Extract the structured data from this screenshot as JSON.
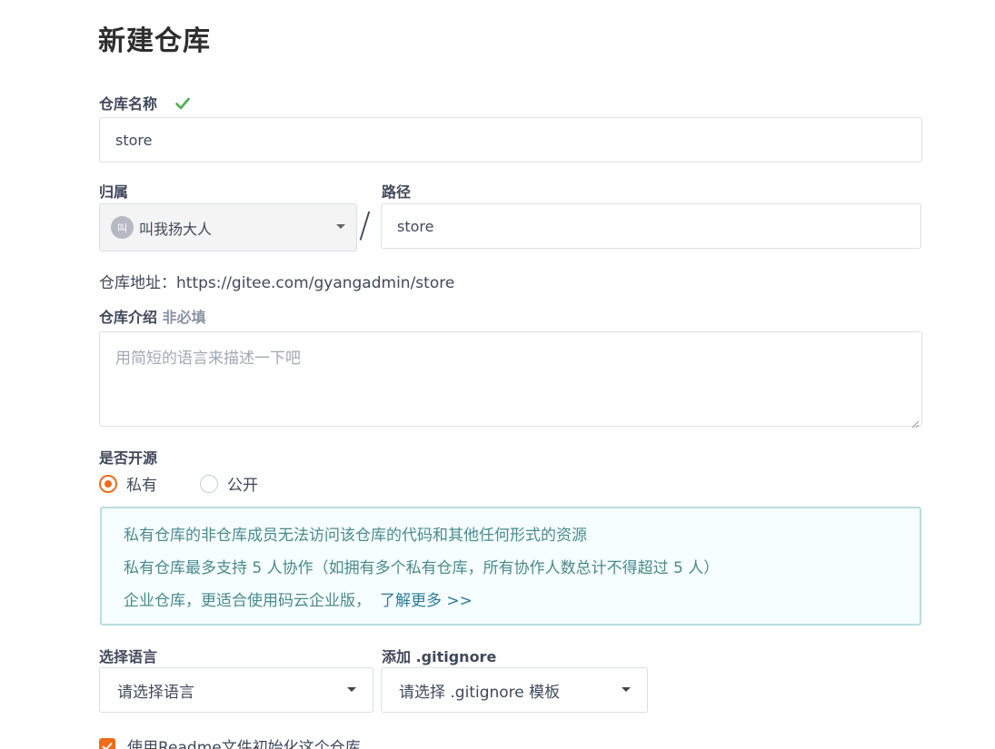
{
  "page": {
    "title": "新建仓库"
  },
  "repo_name": {
    "label": "仓库名称",
    "value": "store",
    "valid_icon": "check-icon"
  },
  "owner": {
    "label": "归属",
    "avatar_text": "叫",
    "value": "叫我扬大人"
  },
  "path": {
    "label": "路径",
    "separator": "/",
    "value": "store"
  },
  "address": {
    "text": "仓库地址：https://gitee.com/gyangadmin/store"
  },
  "description": {
    "label": "仓库介绍",
    "optional": "非必填",
    "placeholder": "用简短的语言来描述一下吧",
    "value": ""
  },
  "visibility": {
    "label": "是否开源",
    "options": [
      {
        "label": "私有",
        "checked": true
      },
      {
        "label": "公开",
        "checked": false
      }
    ]
  },
  "info": {
    "line1": "私有仓库的非仓库成员无法访问该仓库的代码和其他任何形式的资源",
    "line2": "私有仓库最多支持 5 人协作（如拥有多个私有仓库，所有协作人数总计不得超过 5 人）",
    "line3": "企业仓库，更适合使用码云企业版，",
    "link": "了解更多 >>"
  },
  "language": {
    "label": "选择语言",
    "value": "请选择语言"
  },
  "gitignore": {
    "label": "添加 .gitignore",
    "value": "请选择 .gitignore 模板"
  },
  "readme": {
    "label": "使用Readme文件初始化这个仓库",
    "checked": true
  },
  "colors": {
    "accent": "#f06c19",
    "success": "#4caf50",
    "info_border": "#b8dfe0",
    "info_bg": "#f6feff",
    "info_text": "#4a8a8c",
    "link": "#2b7a99"
  }
}
